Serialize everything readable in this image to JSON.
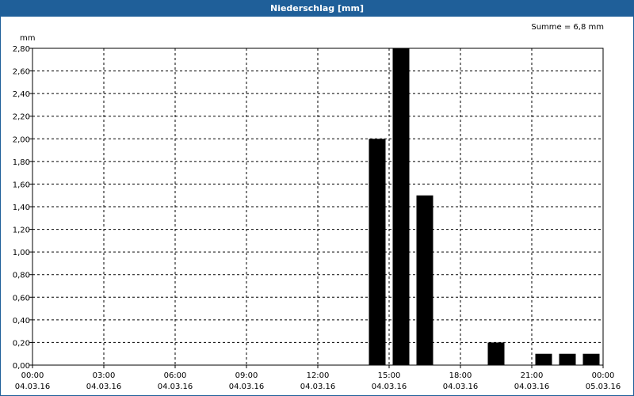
{
  "window": {
    "title": "Niederschlag [mm]"
  },
  "chart_data": {
    "type": "bar",
    "title": "Niederschlag [mm]",
    "ylabel": "mm",
    "annotation": "Summe = 6,8 mm",
    "xlim_hours": [
      0,
      24
    ],
    "ylim": [
      0,
      2.8
    ],
    "y_ticks": [
      "0,00",
      "0,20",
      "0,40",
      "0,60",
      "0,80",
      "1,00",
      "1,20",
      "1,40",
      "1,60",
      "1,80",
      "2,00",
      "2,20",
      "2,40",
      "2,60",
      "2,80"
    ],
    "x_ticks": [
      {
        "time": "00:00",
        "date": "04.03.16"
      },
      {
        "time": "03:00",
        "date": "04.03.16"
      },
      {
        "time": "06:00",
        "date": "04.03.16"
      },
      {
        "time": "09:00",
        "date": "04.03.16"
      },
      {
        "time": "12:00",
        "date": "04.03.16"
      },
      {
        "time": "15:00",
        "date": "04.03.16"
      },
      {
        "time": "18:00",
        "date": "04.03.16"
      },
      {
        "time": "21:00",
        "date": "04.03.16"
      },
      {
        "time": "00:00",
        "date": "05.03.16"
      }
    ],
    "bars": [
      {
        "hour": 14.5,
        "value": 2.0
      },
      {
        "hour": 15.5,
        "value": 2.8
      },
      {
        "hour": 16.5,
        "value": 1.5
      },
      {
        "hour": 19.5,
        "value": 0.2
      },
      {
        "hour": 21.5,
        "value": 0.1
      },
      {
        "hour": 22.5,
        "value": 0.1
      },
      {
        "hour": 23.5,
        "value": 0.1
      }
    ],
    "grid": true,
    "colors": {
      "bar": "#000000",
      "title_bar": "#1f5f99"
    }
  }
}
